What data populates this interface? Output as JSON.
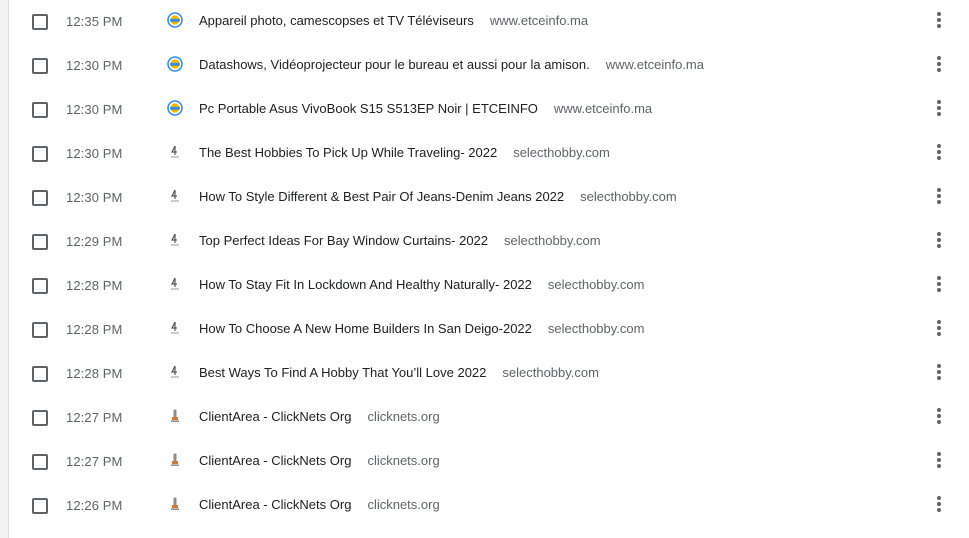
{
  "history": {
    "items": [
      {
        "time": "12:35 PM",
        "title": "Appareil photo, camescopses et TV Téléviseurs",
        "domain": "www.etceinfo.ma",
        "icon": "etceinfo-favicon-icon"
      },
      {
        "time": "12:30 PM",
        "title": "Datashows, Vidéoprojecteur pour le bureau et aussi pour la amison.",
        "domain": "www.etceinfo.ma",
        "icon": "etceinfo-favicon-icon"
      },
      {
        "time": "12:30 PM",
        "title": "Pc Portable Asus VivoBook S15 S513EP Noir | ETCEINFO",
        "domain": "www.etceinfo.ma",
        "icon": "etceinfo-favicon-icon"
      },
      {
        "time": "12:30 PM",
        "title": "The Best Hobbies To Pick Up While Traveling- 2022",
        "domain": "selecthobby.com",
        "icon": "selecthobby-favicon-icon"
      },
      {
        "time": "12:30 PM",
        "title": "How To Style Different & Best Pair Of Jeans-Denim Jeans 2022",
        "domain": "selecthobby.com",
        "icon": "selecthobby-favicon-icon"
      },
      {
        "time": "12:29 PM",
        "title": "Top Perfect Ideas For Bay Window Curtains- 2022",
        "domain": "selecthobby.com",
        "icon": "selecthobby-favicon-icon"
      },
      {
        "time": "12:28 PM",
        "title": "How To Stay Fit In Lockdown And Healthy Naturally- 2022",
        "domain": "selecthobby.com",
        "icon": "selecthobby-favicon-icon"
      },
      {
        "time": "12:28 PM",
        "title": "How To Choose A New Home Builders In San Deigo-2022",
        "domain": "selecthobby.com",
        "icon": "selecthobby-favicon-icon"
      },
      {
        "time": "12:28 PM",
        "title": "Best Ways To Find A Hobby That You’ll Love 2022",
        "domain": "selecthobby.com",
        "icon": "selecthobby-favicon-icon"
      },
      {
        "time": "12:27 PM",
        "title": "ClientArea - ClickNets Org",
        "domain": "clicknets.org",
        "icon": "clicknets-favicon-icon"
      },
      {
        "time": "12:27 PM",
        "title": "ClientArea - ClickNets Org",
        "domain": "clicknets.org",
        "icon": "clicknets-favicon-icon"
      },
      {
        "time": "12:26 PM",
        "title": "ClientArea - ClickNets Org",
        "domain": "clicknets.org",
        "icon": "clicknets-favicon-icon"
      }
    ]
  },
  "colors": {
    "text_primary": "#202124",
    "text_secondary": "#5f6368",
    "etceinfo_blue": "#3b8fd9",
    "etceinfo_yellow": "#f2b705"
  }
}
